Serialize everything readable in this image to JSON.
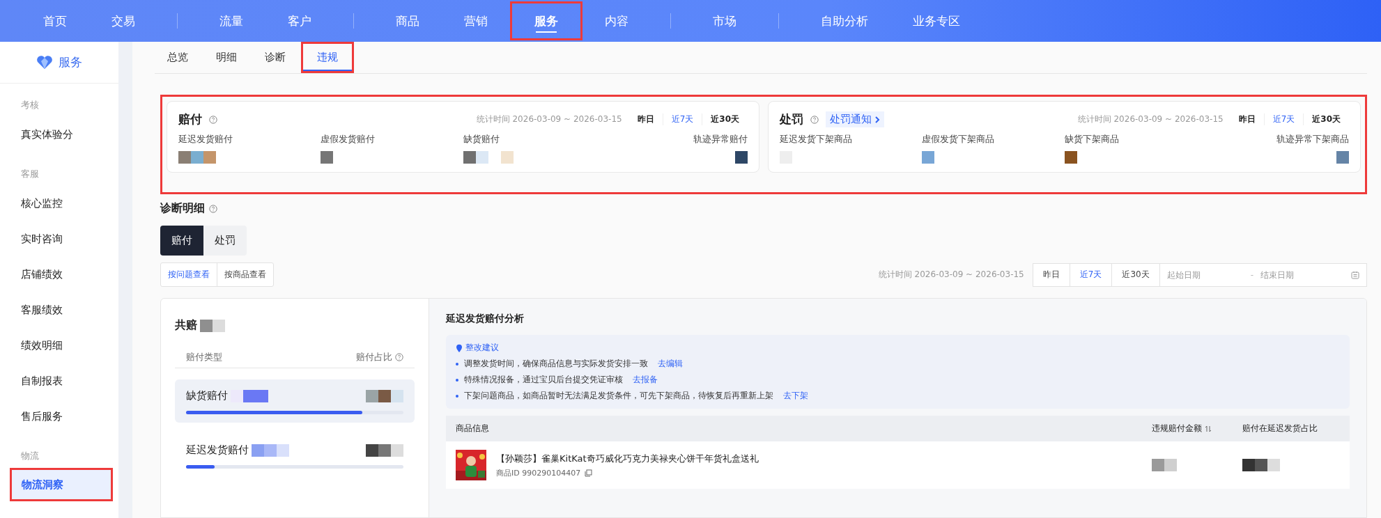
{
  "top_nav": [
    {
      "label": "首页",
      "selected": false,
      "divider_after": false
    },
    {
      "label": "交易",
      "selected": false,
      "divider_after": true
    },
    {
      "label": "流量",
      "selected": false,
      "divider_after": false
    },
    {
      "label": "客户",
      "selected": false,
      "divider_after": true
    },
    {
      "label": "商品",
      "selected": false,
      "divider_after": false
    },
    {
      "label": "营销",
      "selected": false,
      "divider_after": false
    },
    {
      "label": "服务",
      "selected": true,
      "divider_after": false
    },
    {
      "label": "内容",
      "selected": false,
      "divider_after": true
    },
    {
      "label": "市场",
      "selected": false,
      "divider_after": true
    },
    {
      "label": "自助分析",
      "selected": false,
      "divider_after": false
    },
    {
      "label": "业务专区",
      "selected": false,
      "divider_after": false
    }
  ],
  "sidebar": {
    "title": "服务",
    "sections": [
      {
        "heading": "考核",
        "items": [
          {
            "label": "真实体验分",
            "selected": false
          }
        ]
      },
      {
        "heading": "客服",
        "items": [
          {
            "label": "核心监控",
            "selected": false
          },
          {
            "label": "实时咨询",
            "selected": false
          },
          {
            "label": "店铺绩效",
            "selected": false
          },
          {
            "label": "客服绩效",
            "selected": false
          },
          {
            "label": "绩效明细",
            "selected": false
          },
          {
            "label": "自制报表",
            "selected": false
          },
          {
            "label": "售后服务",
            "selected": false
          }
        ]
      },
      {
        "heading": "物流",
        "items": [
          {
            "label": "物流洞察",
            "selected": true
          }
        ]
      }
    ]
  },
  "sub_tabs": [
    {
      "label": "总览",
      "selected": false
    },
    {
      "label": "明细",
      "selected": false
    },
    {
      "label": "诊断",
      "selected": false
    },
    {
      "label": "违规",
      "selected": true
    }
  ],
  "summary_cards": [
    {
      "title": "赔付",
      "period": "统计时间 2026-03-09 ~ 2026-03-15",
      "ranges": [
        {
          "label": "昨日",
          "selected": false
        },
        {
          "label": "近7天",
          "selected": true
        },
        {
          "label": "近30天",
          "selected": false
        }
      ],
      "metrics": [
        "延迟发货赔付",
        "虚假发货赔付",
        "缺货赔付",
        "轨迹异常赔付"
      ]
    },
    {
      "title": "处罚",
      "notice_link": "处罚通知",
      "period": "统计时间 2026-03-09 ~ 2026-03-15",
      "ranges": [
        {
          "label": "昨日",
          "selected": false
        },
        {
          "label": "近7天",
          "selected": true
        },
        {
          "label": "近30天",
          "selected": false
        }
      ],
      "metrics": [
        "延迟发货下架商品",
        "虚假发货下架商品",
        "缺货下架商品",
        "轨迹异常下架商品"
      ]
    }
  ],
  "detail": {
    "title": "诊断明细",
    "type_tabs": [
      {
        "label": "赔付",
        "selected": true
      },
      {
        "label": "处罚",
        "selected": false
      }
    ],
    "view_tabs": [
      {
        "label": "按问题查看",
        "selected": true
      },
      {
        "label": "按商品查看",
        "selected": false
      }
    ],
    "period": "统计时间 2026-03-09 ~ 2026-03-15",
    "ranges": [
      {
        "label": "昨日",
        "selected": false
      },
      {
        "label": "近7天",
        "selected": true
      },
      {
        "label": "近30天",
        "selected": false
      }
    ],
    "start_date": {
      "placeholder": "起始日期"
    },
    "date_separator": "-",
    "end_date": {
      "placeholder": "结束日期"
    },
    "summary": {
      "heading": "共赔",
      "columns": [
        "赔付类型",
        "赔付占比"
      ],
      "rows": [
        {
          "label": "缺货赔付",
          "selected": true,
          "level": 0.81
        },
        {
          "label": "延迟发货赔付",
          "selected": false,
          "level": 0.13
        }
      ]
    },
    "analysis": {
      "title": "延迟发货赔付分析",
      "advice_title": "整改建议",
      "advice": [
        {
          "text": "调整发货时间，确保商品信息与实际发货安排一致",
          "link": "去编辑"
        },
        {
          "text": "特殊情况报备，通过宝贝后台提交凭证审核",
          "link": "去报备"
        },
        {
          "text": "下架问题商品，如商品暂时无法满足发货条件，可先下架商品，待恢复后再重新上架",
          "link": "去下架"
        }
      ],
      "columns": [
        "商品信息",
        "违规赔付金额",
        "赔付在延迟发货占比"
      ],
      "rows": [
        {
          "title": "【孙颖莎】雀巢KitKat奇巧威化巧克力美禄夹心饼干年货礼盒送礼",
          "product_id": "商品ID 990290104407"
        }
      ]
    }
  }
}
